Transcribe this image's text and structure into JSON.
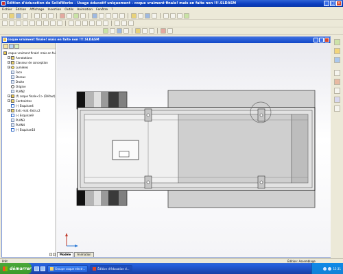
{
  "window": {
    "title": "Édition d'éducation de SolidWorks - Usage éducatif uniquement - coque vraiment finale! mais en faite non !!!.SLDASM"
  },
  "menu": [
    "Fichier",
    "Édition",
    "Affichage",
    "Insertion",
    "Outils",
    "Animation",
    "Fenêtre",
    "?"
  ],
  "document": {
    "title": "coque vraiment finale! mais en faite non !!!.SLDASM"
  },
  "tree": {
    "root": "coque vraiment finale! mais en fai",
    "items": [
      {
        "label": "Annotations",
        "icon": "annotations-icon"
      },
      {
        "label": "Classeur de conception",
        "icon": "design-binder-icon"
      },
      {
        "label": "Lumières",
        "icon": "lights-icon"
      },
      {
        "label": "Face",
        "icon": "plane-icon"
      },
      {
        "label": "Dessus",
        "icon": "plane-icon"
      },
      {
        "label": "Droite",
        "icon": "plane-icon"
      },
      {
        "label": "Origine",
        "icon": "origin-icon"
      },
      {
        "label": "PLAN2",
        "icon": "plane-icon"
      },
      {
        "label": "(f) coque finale<1> (Défaut)",
        "icon": "part-icon"
      },
      {
        "label": "Contraintes",
        "icon": "mates-icon"
      },
      {
        "label": "(-) Esquisse4",
        "icon": "sketch-icon"
      },
      {
        "label": "Extr.-mat.-Extru.2",
        "icon": "extrude-icon"
      },
      {
        "label": "(-) Esquisse9",
        "icon": "sketch-icon"
      },
      {
        "label": "PLAN3",
        "icon": "plane-icon"
      },
      {
        "label": "PLAN4",
        "icon": "plane-icon"
      },
      {
        "label": "(-) Esquisse10",
        "icon": "sketch-icon"
      }
    ]
  },
  "tabs": {
    "model": "Modèle",
    "animation": "Animation"
  },
  "status": {
    "left": "Prêt",
    "right": "Édition: Assemblage"
  },
  "taskbar": {
    "start": "démarrer",
    "tasks": [
      "Groupe coque electr...",
      "Édition d'éducation d..."
    ],
    "clock": "15:31"
  },
  "colors": {
    "titlebar": "#0a3dbf",
    "taskbar": "#245edb",
    "start": "#3c9a2b",
    "model_gray": "#c8c8c8"
  }
}
